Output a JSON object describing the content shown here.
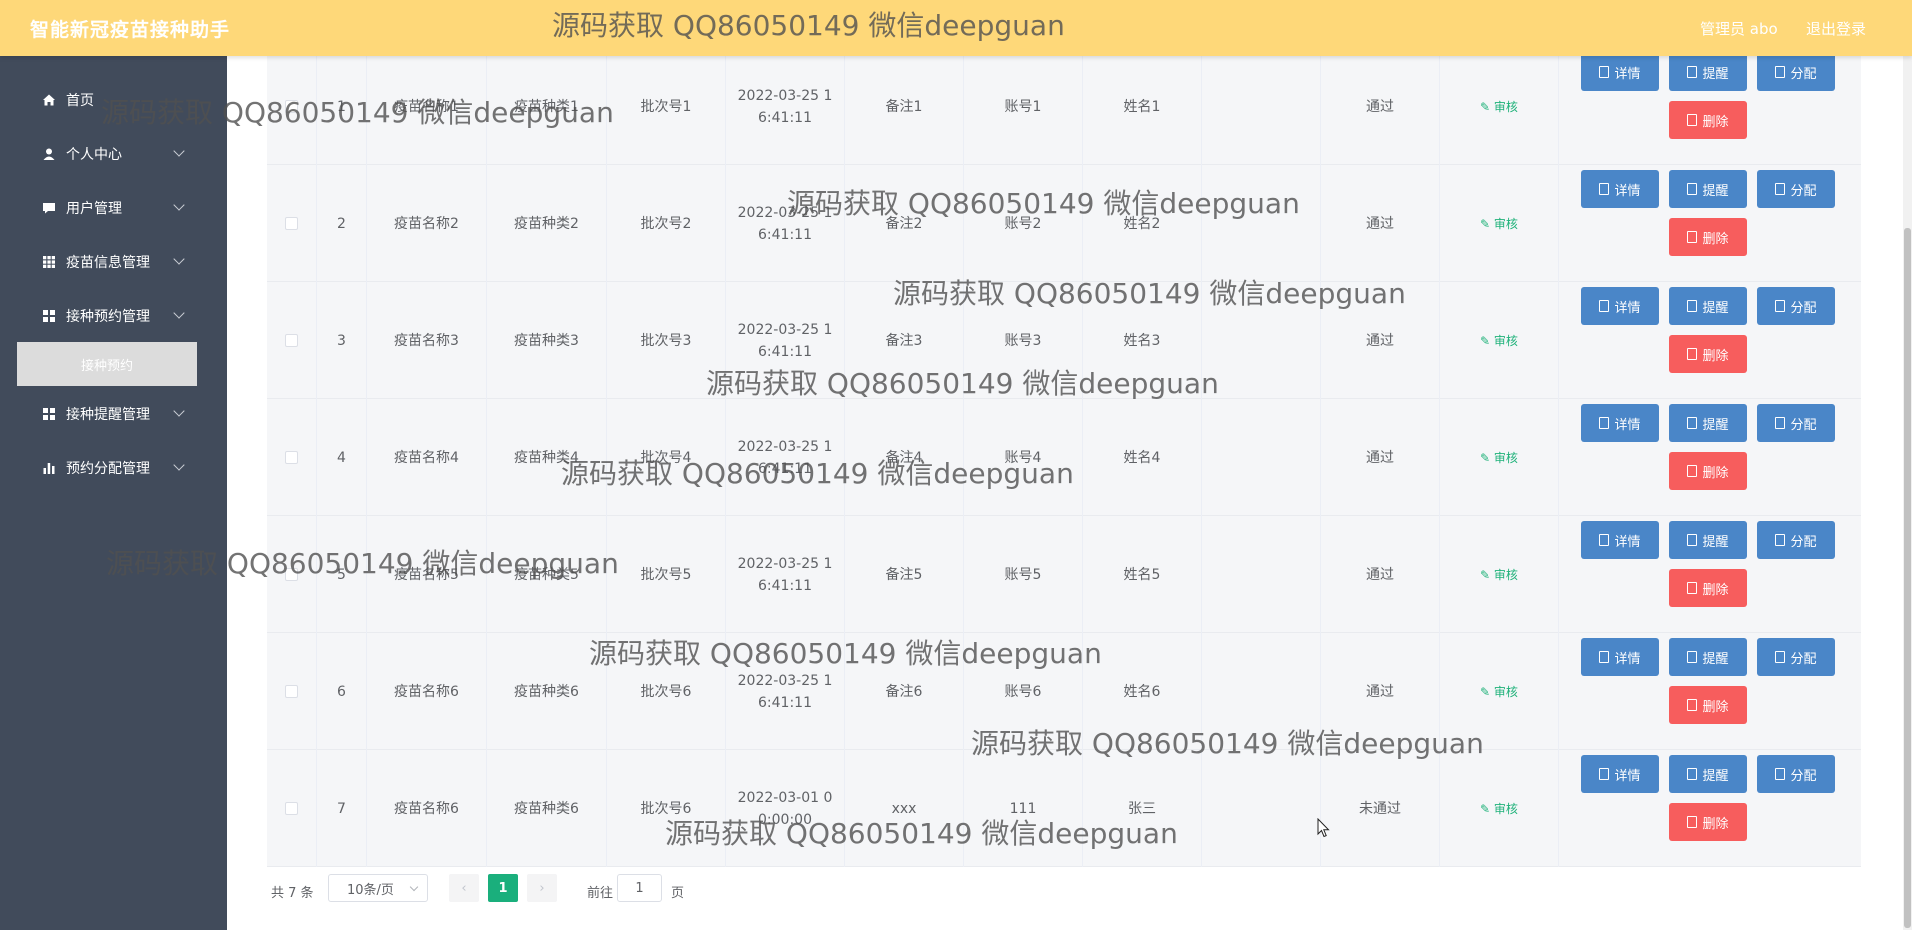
{
  "header": {
    "title": "智能新冠疫苗接种助手",
    "user": "管理员 abo",
    "logout": "退出登录"
  },
  "sidebar": {
    "items": [
      {
        "label": "首页",
        "icon": "home-icon"
      },
      {
        "label": "个人中心",
        "icon": "user-icon"
      },
      {
        "label": "用户管理",
        "icon": "chat-icon"
      },
      {
        "label": "疫苗信息管理",
        "icon": "grid-icon"
      },
      {
        "label": "接种预约管理",
        "icon": "grid-icon"
      },
      {
        "label": "接种提醒管理",
        "icon": "grid-icon"
      },
      {
        "label": "预约分配管理",
        "icon": "bar-chart-icon"
      }
    ],
    "active_sub": "接种预约"
  },
  "table": {
    "rows": [
      {
        "idx": "1",
        "name": "疫苗名称1",
        "type": "疫苗种类1",
        "batch": "批次号1",
        "time": "2022-03-25 1 6:41:11",
        "note": "备注1",
        "account": "账号1",
        "person": "姓名1",
        "status": "通过"
      },
      {
        "idx": "2",
        "name": "疫苗名称2",
        "type": "疫苗种类2",
        "batch": "批次号2",
        "time": "2022-03-25 1 6:41:11",
        "note": "备注2",
        "account": "账号2",
        "person": "姓名2",
        "status": "通过"
      },
      {
        "idx": "3",
        "name": "疫苗名称3",
        "type": "疫苗种类3",
        "batch": "批次号3",
        "time": "2022-03-25 1 6:41:11",
        "note": "备注3",
        "account": "账号3",
        "person": "姓名3",
        "status": "通过"
      },
      {
        "idx": "4",
        "name": "疫苗名称4",
        "type": "疫苗种类4",
        "batch": "批次号4",
        "time": "2022-03-25 1 6:41:11",
        "note": "备注4",
        "account": "账号4",
        "person": "姓名4",
        "status": "通过"
      },
      {
        "idx": "5",
        "name": "疫苗名称5",
        "type": "疫苗种类5",
        "batch": "批次号5",
        "time": "2022-03-25 1 6:41:11",
        "note": "备注5",
        "account": "账号5",
        "person": "姓名5",
        "status": "通过"
      },
      {
        "idx": "6",
        "name": "疫苗名称6",
        "type": "疫苗种类6",
        "batch": "批次号6",
        "time": "2022-03-25 1 6:41:11",
        "note": "备注6",
        "account": "账号6",
        "person": "姓名6",
        "status": "通过"
      },
      {
        "idx": "7",
        "name": "疫苗名称6",
        "type": "疫苗种类6",
        "batch": "批次号6",
        "time": "2022-03-01 0 0:00:00",
        "note": "xxx",
        "account": "111",
        "person": "张三",
        "status": "未通过"
      }
    ],
    "audit_label": "审核",
    "btn_detail": "详情",
    "btn_remind": "提醒",
    "btn_assign": "分配",
    "btn_delete": "删除"
  },
  "pagination": {
    "total": "共 7 条",
    "page_size": "10条/页",
    "current_page": "1",
    "goto_prefix": "前往",
    "goto_value": "1",
    "goto_suffix": "页"
  },
  "watermark": "源码获取 QQ86050149 微信deepguan",
  "colors": {
    "header_bg": "#fed879",
    "sidebar_bg": "#414b5b",
    "primary_button": "#4a86c8",
    "danger_button": "#f75d5d",
    "accent_green": "#1aaf7c"
  }
}
